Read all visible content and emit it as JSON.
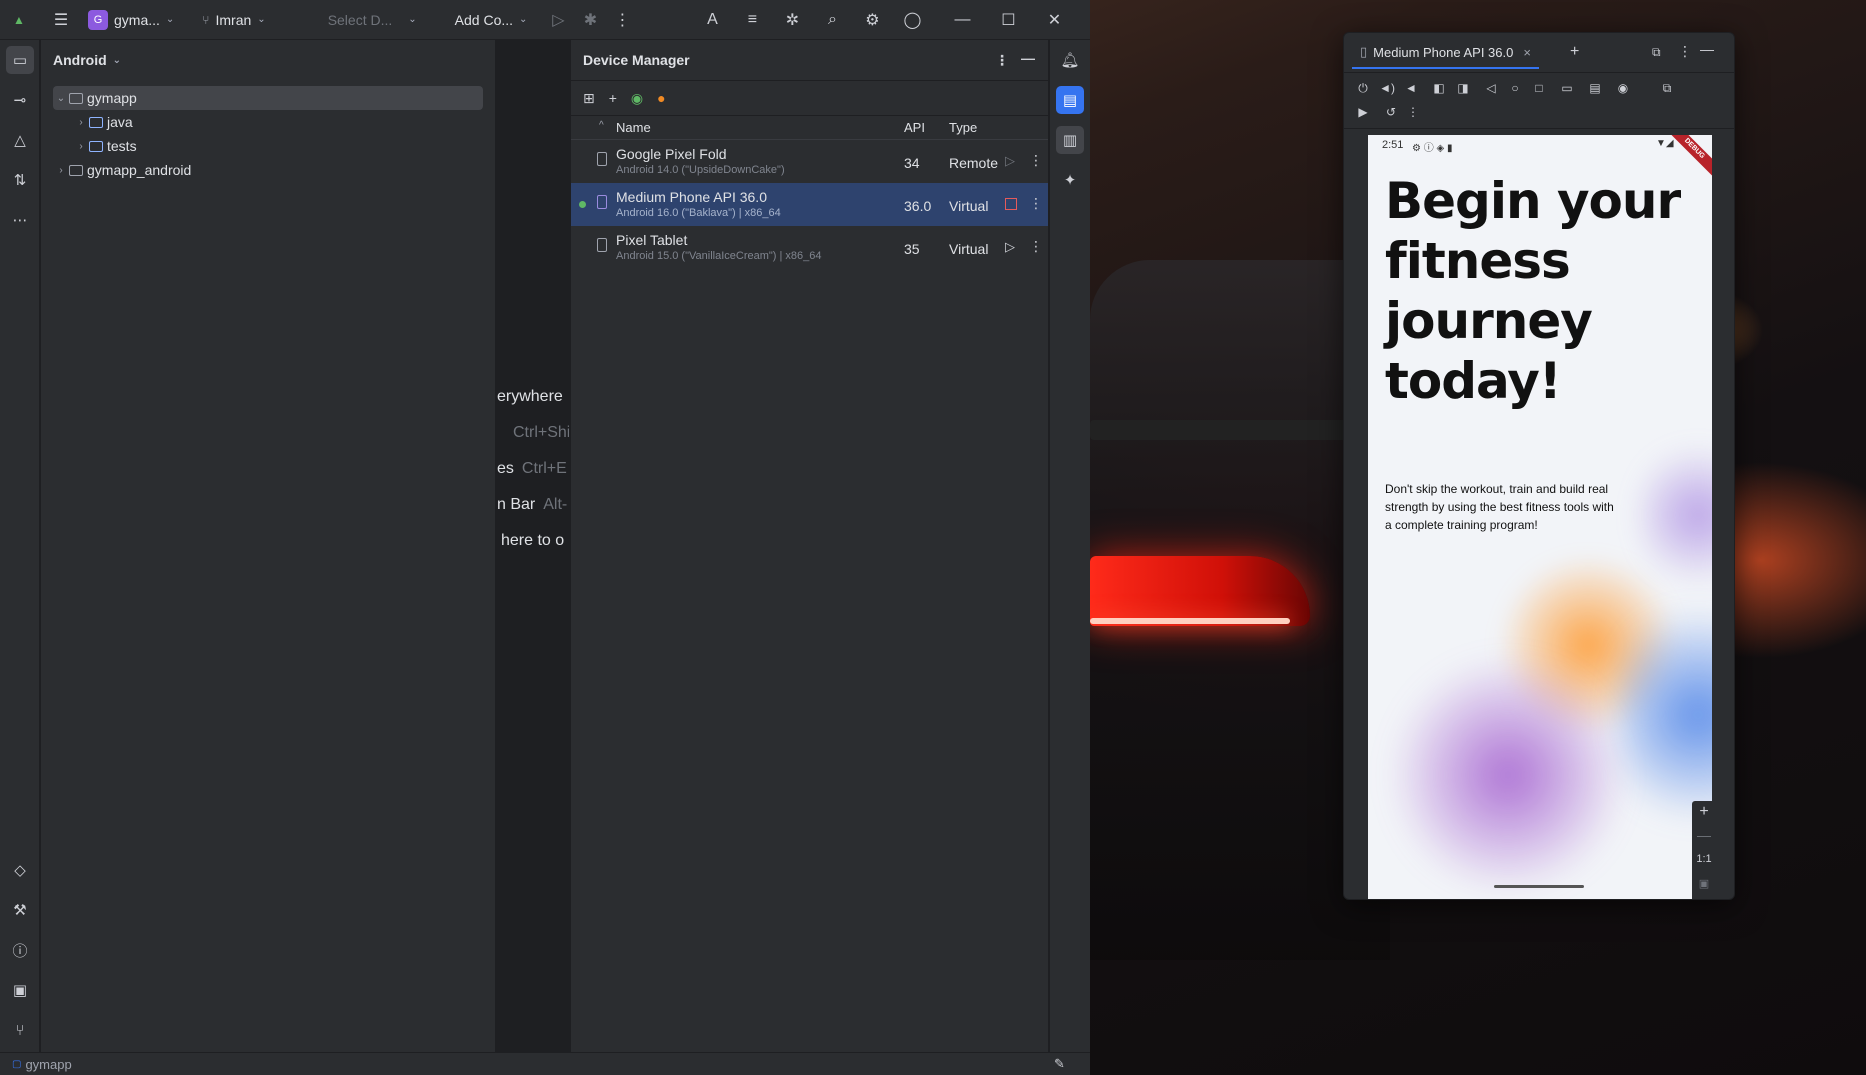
{
  "titlebar": {
    "project_badge": "G",
    "project_name": "gyma...",
    "branch": "Imran",
    "device_selector_placeholder": "Select D...",
    "run_config": "Add Co..."
  },
  "project_panel": {
    "view_mode": "Android",
    "tree": [
      {
        "label": "gymapp",
        "level": 0,
        "expanded": true,
        "selected": true
      },
      {
        "label": "java",
        "level": 1,
        "expanded": false
      },
      {
        "label": "tests",
        "level": 1,
        "expanded": false
      },
      {
        "label": "gymapp_android",
        "level": 0,
        "expanded": false
      }
    ]
  },
  "editor_hints": [
    {
      "text": "erywhere",
      "key": ""
    },
    {
      "text": "",
      "key": "Ctrl+Shi"
    },
    {
      "text": "es",
      "key": "Ctrl+E"
    },
    {
      "text": "n Bar",
      "key": "Alt-"
    },
    {
      "text": "here to o",
      "key": ""
    }
  ],
  "device_manager": {
    "title": "Device Manager",
    "columns": {
      "name": "Name",
      "api": "API",
      "type": "Type"
    },
    "devices": [
      {
        "name": "Google Pixel Fold",
        "sub": "Android 14.0 (\"UpsideDownCake\")",
        "api": "34",
        "type": "Remote",
        "running": false,
        "selected": false
      },
      {
        "name": "Medium Phone API 36.0",
        "sub": "Android 16.0 (\"Baklava\") | x86_64",
        "api": "36.0",
        "type": "Virtual",
        "running": true,
        "selected": true
      },
      {
        "name": "Pixel Tablet",
        "sub": "Android 15.0 (\"VanillaIceCream\") | x86_64",
        "api": "35",
        "type": "Virtual",
        "running": false,
        "selected": false
      }
    ]
  },
  "statusbar": {
    "breadcrumb": "gymapp"
  },
  "emulator": {
    "tab_label": "Medium Phone API 36.0",
    "phone": {
      "time": "2:51",
      "debug_label": "DEBUG",
      "headline": "Begin your fitness journey today!",
      "body": "Don't skip the workout, train and build real strength by using the best fitness tools with a complete training program!",
      "zoom_label": "1:1"
    }
  },
  "colors": {
    "accent": "#3574f0",
    "selection": "#2e436e",
    "running": "#5fb865",
    "stop": "#e55b5b"
  }
}
